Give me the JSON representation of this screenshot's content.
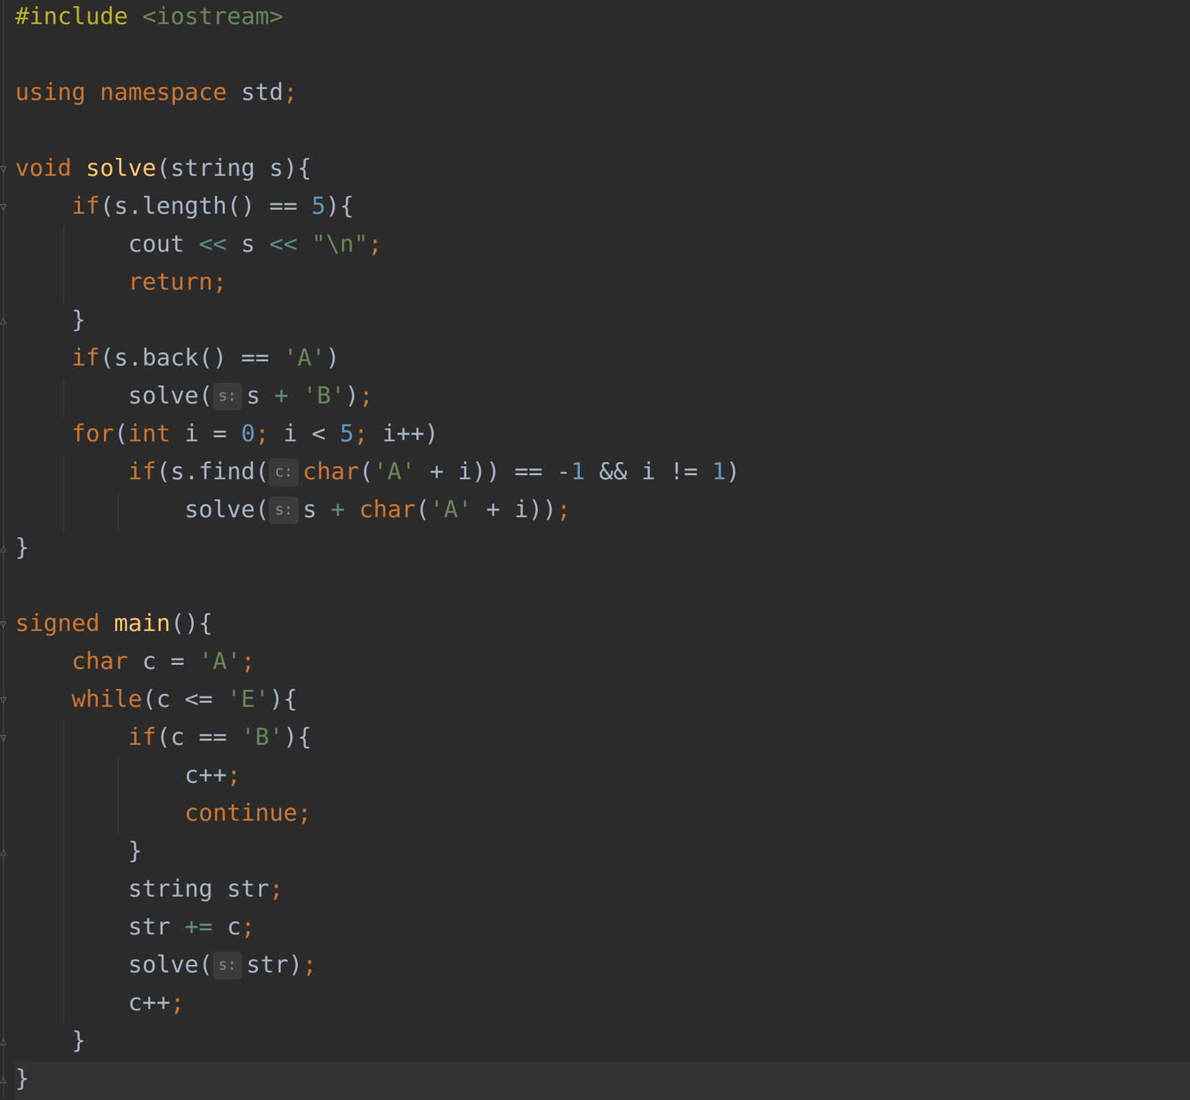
{
  "editor": {
    "colors": {
      "background": "#2b2b2b",
      "keyword": "#cc7832",
      "preprocessor": "#bbb529",
      "function": "#ffc66d",
      "number": "#6897bb",
      "string": "#6a8759",
      "operator": "#5f8c8a",
      "plain": "#a9b7c6",
      "hint": "#8a8a8a"
    },
    "lines": [
      {
        "tokens": [
          [
            "pp",
            "#include"
          ],
          [
            "pl",
            " "
          ],
          [
            "inc",
            "<iostream>"
          ]
        ]
      },
      {
        "tokens": []
      },
      {
        "tokens": [
          [
            "kw",
            "using"
          ],
          [
            "pl",
            " "
          ],
          [
            "kw",
            "namespace"
          ],
          [
            "pl",
            " std"
          ],
          [
            "kw",
            ";"
          ]
        ]
      },
      {
        "tokens": []
      },
      {
        "fold": "open",
        "tokens": [
          [
            "kw",
            "void"
          ],
          [
            "pl",
            " "
          ],
          [
            "fn",
            "solve"
          ],
          [
            "pl",
            "(string s){"
          ]
        ]
      },
      {
        "fold": "open",
        "tokens": [
          [
            "pl",
            "    "
          ],
          [
            "kw",
            "if"
          ],
          [
            "pl",
            "(s.length() == "
          ],
          [
            "num",
            "5"
          ],
          [
            "pl",
            "){"
          ]
        ]
      },
      {
        "guides": [
          1
        ],
        "tokens": [
          [
            "pl",
            "        cout "
          ],
          [
            "op",
            "<<"
          ],
          [
            "pl",
            " s "
          ],
          [
            "op",
            "<<"
          ],
          [
            "pl",
            " "
          ],
          [
            "str",
            "\"\\n\""
          ],
          [
            "kw",
            ";"
          ]
        ]
      },
      {
        "guides": [
          1
        ],
        "tokens": [
          [
            "pl",
            "        "
          ],
          [
            "kw",
            "return;"
          ]
        ]
      },
      {
        "fold": "close",
        "tokens": [
          [
            "pl",
            "    }"
          ]
        ]
      },
      {
        "tokens": [
          [
            "pl",
            "    "
          ],
          [
            "kw",
            "if"
          ],
          [
            "pl",
            "(s.back() == "
          ],
          [
            "str",
            "'A'"
          ],
          [
            "pl",
            ")"
          ]
        ]
      },
      {
        "guides": [
          1
        ],
        "tokens": [
          [
            "pl",
            "        solve("
          ],
          [
            "hint",
            "s:"
          ],
          [
            "pl",
            "s "
          ],
          [
            "op",
            "+"
          ],
          [
            "pl",
            " "
          ],
          [
            "str",
            "'B'"
          ],
          [
            "pl",
            ")"
          ],
          [
            "kw",
            ";"
          ]
        ]
      },
      {
        "tokens": [
          [
            "pl",
            "    "
          ],
          [
            "kw",
            "for"
          ],
          [
            "pl",
            "("
          ],
          [
            "kw",
            "int"
          ],
          [
            "pl",
            " i = "
          ],
          [
            "num",
            "0"
          ],
          [
            "kw",
            ";"
          ],
          [
            "pl",
            " i < "
          ],
          [
            "num",
            "5"
          ],
          [
            "kw",
            ";"
          ],
          [
            "pl",
            " i++)"
          ]
        ]
      },
      {
        "guides": [
          1
        ],
        "tokens": [
          [
            "pl",
            "        "
          ],
          [
            "kw",
            "if"
          ],
          [
            "pl",
            "(s.find("
          ],
          [
            "hint",
            "c:"
          ],
          [
            "kw",
            "char"
          ],
          [
            "pl",
            "("
          ],
          [
            "str",
            "'A'"
          ],
          [
            "pl",
            " + i)) == -"
          ],
          [
            "num",
            "1"
          ],
          [
            "pl",
            " && i != "
          ],
          [
            "num",
            "1"
          ],
          [
            "pl",
            ")"
          ]
        ]
      },
      {
        "guides": [
          1,
          2
        ],
        "tokens": [
          [
            "pl",
            "            solve("
          ],
          [
            "hint",
            "s:"
          ],
          [
            "pl",
            "s "
          ],
          [
            "op",
            "+"
          ],
          [
            "pl",
            " "
          ],
          [
            "kw",
            "char"
          ],
          [
            "pl",
            "("
          ],
          [
            "str",
            "'A'"
          ],
          [
            "pl",
            " + i))"
          ],
          [
            "kw",
            ";"
          ]
        ]
      },
      {
        "fold": "close",
        "tokens": [
          [
            "pl",
            "}"
          ]
        ]
      },
      {
        "tokens": []
      },
      {
        "fold": "open",
        "tokens": [
          [
            "kw",
            "signed"
          ],
          [
            "pl",
            " "
          ],
          [
            "fn",
            "main"
          ],
          [
            "pl",
            "(){"
          ]
        ]
      },
      {
        "tokens": [
          [
            "pl",
            "    "
          ],
          [
            "kw",
            "char"
          ],
          [
            "pl",
            " c = "
          ],
          [
            "str",
            "'A'"
          ],
          [
            "kw",
            ";"
          ]
        ]
      },
      {
        "fold": "open",
        "tokens": [
          [
            "pl",
            "    "
          ],
          [
            "kw",
            "while"
          ],
          [
            "pl",
            "(c <= "
          ],
          [
            "str",
            "'E'"
          ],
          [
            "pl",
            "){"
          ]
        ]
      },
      {
        "fold": "open",
        "guides": [
          1
        ],
        "tokens": [
          [
            "pl",
            "        "
          ],
          [
            "kw",
            "if"
          ],
          [
            "pl",
            "(c == "
          ],
          [
            "str",
            "'B'"
          ],
          [
            "pl",
            "){"
          ]
        ]
      },
      {
        "guides": [
          1,
          2
        ],
        "tokens": [
          [
            "pl",
            "            c++"
          ],
          [
            "kw",
            ";"
          ]
        ]
      },
      {
        "guides": [
          1,
          2
        ],
        "tokens": [
          [
            "pl",
            "            "
          ],
          [
            "kw",
            "continue;"
          ]
        ]
      },
      {
        "fold": "close",
        "guides": [
          1
        ],
        "tokens": [
          [
            "pl",
            "        }"
          ]
        ]
      },
      {
        "guides": [
          1
        ],
        "tokens": [
          [
            "pl",
            "        string str"
          ],
          [
            "kw",
            ";"
          ]
        ]
      },
      {
        "guides": [
          1
        ],
        "tokens": [
          [
            "pl",
            "        str "
          ],
          [
            "op",
            "+="
          ],
          [
            "pl",
            " c"
          ],
          [
            "kw",
            ";"
          ]
        ]
      },
      {
        "guides": [
          1
        ],
        "tokens": [
          [
            "pl",
            "        solve("
          ],
          [
            "hint",
            "s:"
          ],
          [
            "pl",
            "str)"
          ],
          [
            "kw",
            ";"
          ]
        ]
      },
      {
        "guides": [
          1
        ],
        "tokens": [
          [
            "pl",
            "        c++"
          ],
          [
            "kw",
            ";"
          ]
        ]
      },
      {
        "fold": "close",
        "tokens": [
          [
            "pl",
            "    }"
          ]
        ]
      },
      {
        "fold": "close",
        "current": true,
        "tokens": [
          [
            "pl",
            "}"
          ]
        ]
      }
    ]
  }
}
